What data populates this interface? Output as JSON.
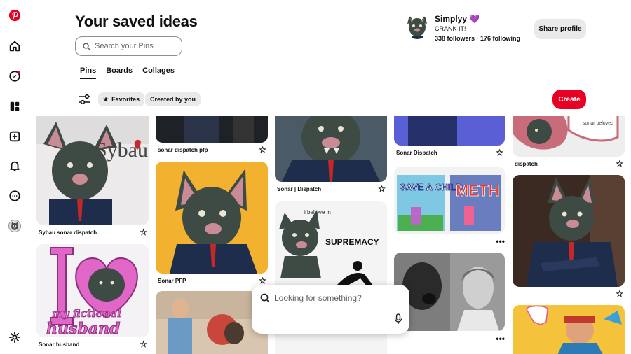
{
  "header": {
    "title": "Your saved ideas",
    "search_placeholder": "Search your Pins",
    "tabs": [
      {
        "label": "Pins",
        "active": true
      },
      {
        "label": "Boards",
        "active": false
      },
      {
        "label": "Collages",
        "active": false
      }
    ]
  },
  "profile": {
    "name": "Simplyy",
    "emoji": "💜",
    "bio": "CRANK IT!",
    "followers": "338 followers",
    "following": "176 following",
    "share_label": "Share profile"
  },
  "filters": {
    "favorites_label": "Favorites",
    "created_label": "Created by you",
    "create_label": "Create"
  },
  "pins": {
    "c1_1": "Sybau sonar dispatch",
    "c1_2": "Sonar husband",
    "c2_1": "sonar dispatch pfp",
    "c2_2": "Sonar PFP",
    "c3_1": "Sonar | Dispatch",
    "c4_1": "Sonar Dispatch",
    "c5_1": "dispatch"
  },
  "pin_text": {
    "sybau": "Sybau",
    "sonar_beloved": "sonar beloved",
    "i_believe": "i believe in",
    "supremacy": "SUPREMACY",
    "save_a_child": "SAVE A CHILD",
    "meth": "METH",
    "my_fictional": "my fictional",
    "husband": "husband"
  },
  "floating_search": {
    "placeholder": "Looking for something?"
  },
  "colors": {
    "brand_red": "#e60023",
    "chip_gray": "#e9e9e9"
  },
  "icons": [
    "pinterest-logo",
    "home-icon",
    "explore-icon",
    "boards-icon",
    "create-icon",
    "bell-icon",
    "messages-icon",
    "avatar",
    "settings-icon",
    "search-icon",
    "filter-icon",
    "star-icon",
    "mic-icon"
  ]
}
